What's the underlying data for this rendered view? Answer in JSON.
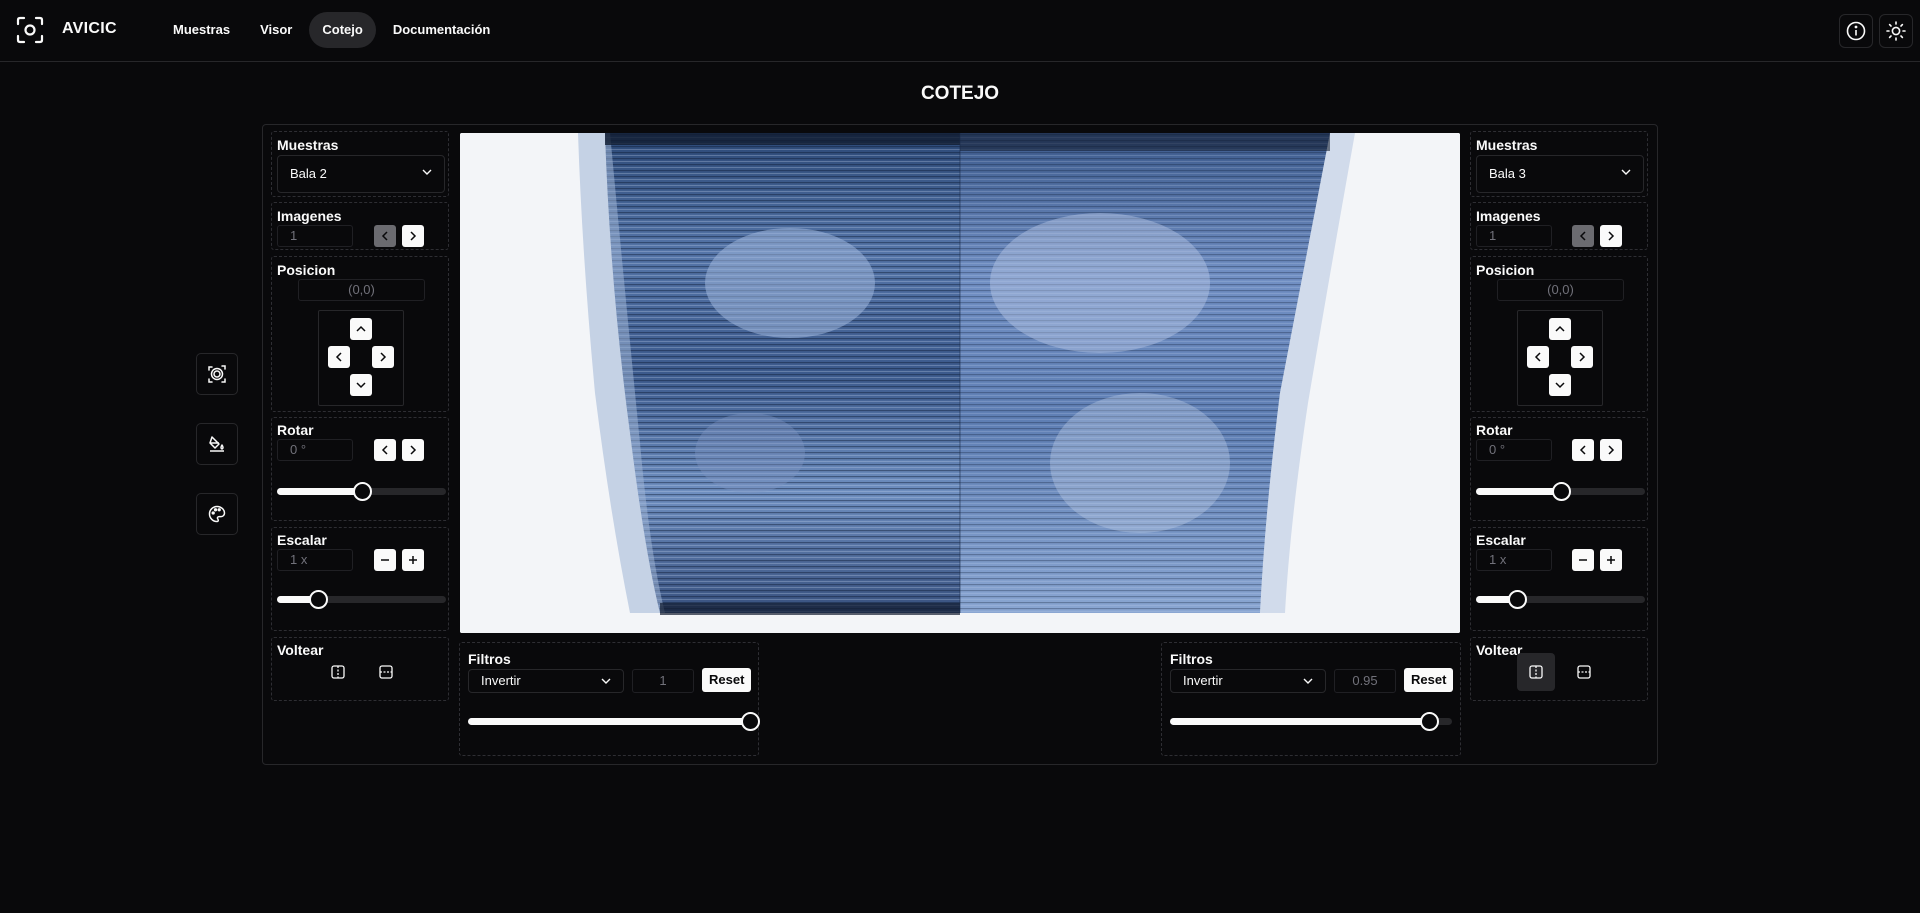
{
  "app": {
    "name": "AVICIC"
  },
  "nav": {
    "items": [
      "Muestras",
      "Visor",
      "Cotejo",
      "Documentación"
    ],
    "active": "Cotejo"
  },
  "page": {
    "title": "COTEJO"
  },
  "left": {
    "muestras_label": "Muestras",
    "muestras_value": "Bala 2",
    "imagenes_label": "Imagenes",
    "imagenes_value": "1",
    "posicion_label": "Posicion",
    "posicion_value": "(0,0)",
    "rotar_label": "Rotar",
    "rotar_value": "0 °",
    "rotar_level": 0.5,
    "escalar_label": "Escalar",
    "escalar_value": "1 x",
    "escalar_level": 0.24,
    "voltear_label": "Voltear",
    "filtros_label": "Filtros",
    "filtro_value": "Invertir",
    "filtro_amount": "1",
    "filtro_level": 1.0,
    "reset_label": "Reset"
  },
  "right": {
    "muestras_label": "Muestras",
    "muestras_value": "Bala 3",
    "imagenes_label": "Imagenes",
    "imagenes_value": "1",
    "posicion_label": "Posicion",
    "posicion_value": "(0,0)",
    "rotar_label": "Rotar",
    "rotar_value": "0 °",
    "rotar_level": 0.5,
    "escalar_label": "Escalar",
    "escalar_value": "1 x",
    "escalar_level": 0.24,
    "voltear_label": "Voltear",
    "filtros_label": "Filtros",
    "filtro_value": "Invertir",
    "filtro_amount": "0.95",
    "filtro_level": 0.92,
    "reset_label": "Reset"
  },
  "icons": {
    "logo": "scan-focus-icon",
    "info": "info-icon",
    "theme": "sun-icon",
    "tools": [
      "focus-icon",
      "paint-bucket-icon",
      "palette-icon"
    ]
  },
  "colors": {
    "background": "#09090b",
    "accent": "#fafafa",
    "border": "#27272a"
  }
}
